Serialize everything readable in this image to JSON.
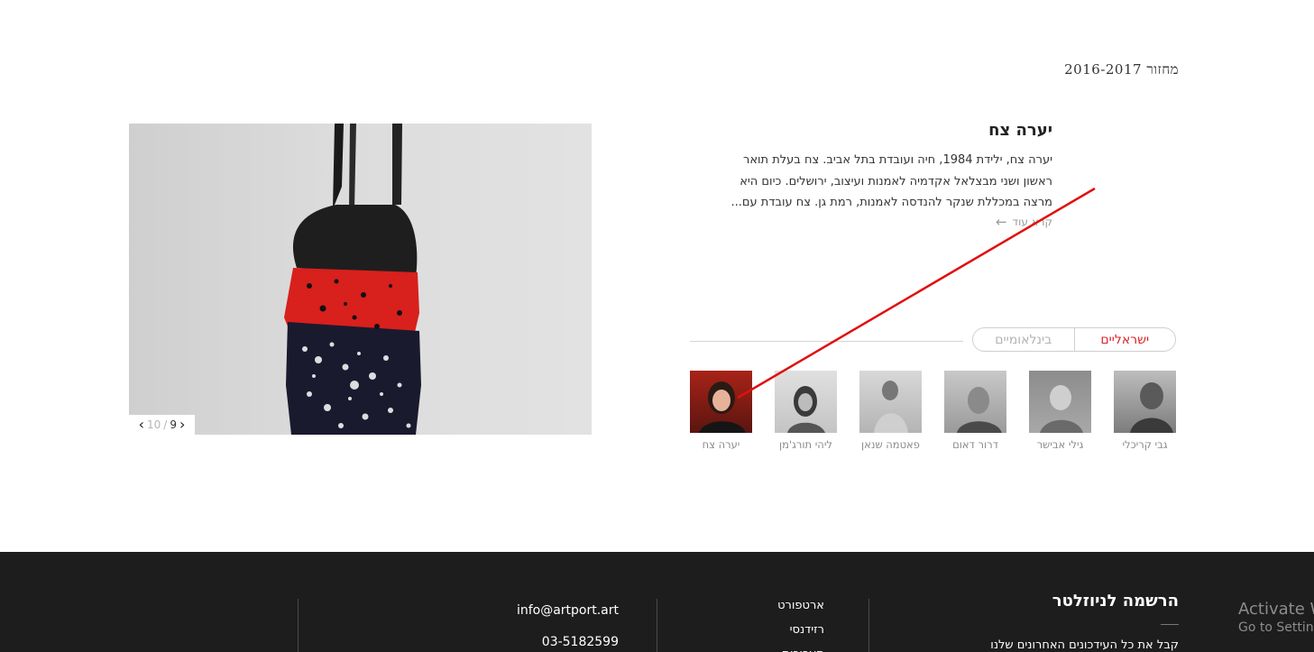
{
  "cohort": "מחזור 2016-2017",
  "artist": {
    "name": "יערה צח",
    "bio": "יערה צח, ילידת 1984, חיה ועובדת בתל אביב. צח בעלת תואר ראשון ושני מבצלאל אקדמיה לאמנות ועיצוב, ירושלים. כיום היא מרצה במכללת שנקר להנדסה לאמנות, רמת גן. צח עובדת עם...",
    "read_more": "קרא עוד"
  },
  "gallery": {
    "current": "9",
    "total": "10"
  },
  "tabs": {
    "israeli": "ישראליים",
    "international": "בינלאומיים"
  },
  "artists": [
    {
      "name": "גבי קריכלי"
    },
    {
      "name": "גילי אבישר"
    },
    {
      "name": "דרור דאום"
    },
    {
      "name": "פאטמה שנאן"
    },
    {
      "name": "ליהי תורג'מן"
    },
    {
      "name": "יערה צח"
    }
  ],
  "footer": {
    "newsletter_title": "הרשמה לניוזלטר",
    "newsletter_sub": "קבל את כל העידכונים האחרונים שלנו",
    "links": [
      "ארטפורט",
      "רזידנסי",
      "תערוכות"
    ],
    "email": "info@artport.art",
    "phone": "03-5182599"
  },
  "activate": {
    "line1": "Activate W",
    "line2": "Go to Setting"
  },
  "colors": {
    "accent": "#d8262a",
    "footer_bg": "#1d1d1d",
    "annotation": "#e01010"
  }
}
